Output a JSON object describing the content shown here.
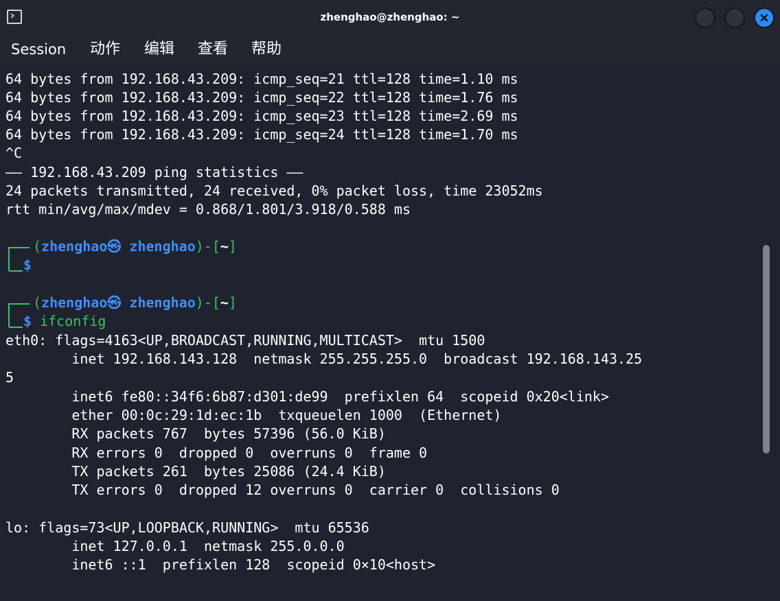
{
  "window": {
    "title": "zhenghao@zhenghao: ~",
    "accent_color": "#2a8cf7",
    "background_color": "#1f2330"
  },
  "menu": {
    "session": "Session",
    "action": "动作",
    "edit": "编辑",
    "view": "查看",
    "help": "帮助"
  },
  "terminal": {
    "ping_lines": [
      "64 bytes from 192.168.43.209: icmp_seq=21 ttl=128 time=1.10 ms",
      "64 bytes from 192.168.43.209: icmp_seq=22 ttl=128 time=1.76 ms",
      "64 bytes from 192.168.43.209: icmp_seq=23 ttl=128 time=2.69 ms",
      "64 bytes from 192.168.43.209: icmp_seq=24 ttl=128 time=1.70 ms"
    ],
    "interrupt": "^C",
    "stats_header": "—— 192.168.43.209 ping statistics ——",
    "stats_packets": "24 packets transmitted, 24 received, 0% packet loss, time 23052ms",
    "stats_rtt": "rtt min/avg/max/mdev = 0.868/1.801/3.918/0.588 ms",
    "prompt": {
      "open_paren": "(",
      "user": "zhenghao",
      "at_symbol": "㉿",
      "host": "zhenghao",
      "close_paren_dash": ")-[",
      "dir": "~",
      "close_bracket": "]",
      "dollar": "$"
    },
    "command": "ifconfig",
    "ifconfig_lines": [
      "eth0: flags=4163<UP,BROADCAST,RUNNING,MULTICAST>  mtu 1500",
      "        inet 192.168.143.128  netmask 255.255.255.0  broadcast 192.168.143.25",
      "5",
      "        inet6 fe80::34f6:6b87:d301:de99  prefixlen 64  scopeid 0x20<link>",
      "        ether 00:0c:29:1d:ec:1b  txqueuelen 1000  (Ethernet)",
      "        RX packets 767  bytes 57396 (56.0 KiB)",
      "        RX errors 0  dropped 0  overruns 0  frame 0",
      "        TX packets 261  bytes 25086 (24.4 KiB)",
      "        TX errors 0  dropped 12 overruns 0  carrier 0  collisions 0",
      "",
      "lo: flags=73<UP,LOOPBACK,RUNNING>  mtu 65536",
      "        inet 127.0.0.1  netmask 255.0.0.0",
      "        inet6 ::1  prefixlen 128  scopeid 0×10<host>"
    ]
  }
}
